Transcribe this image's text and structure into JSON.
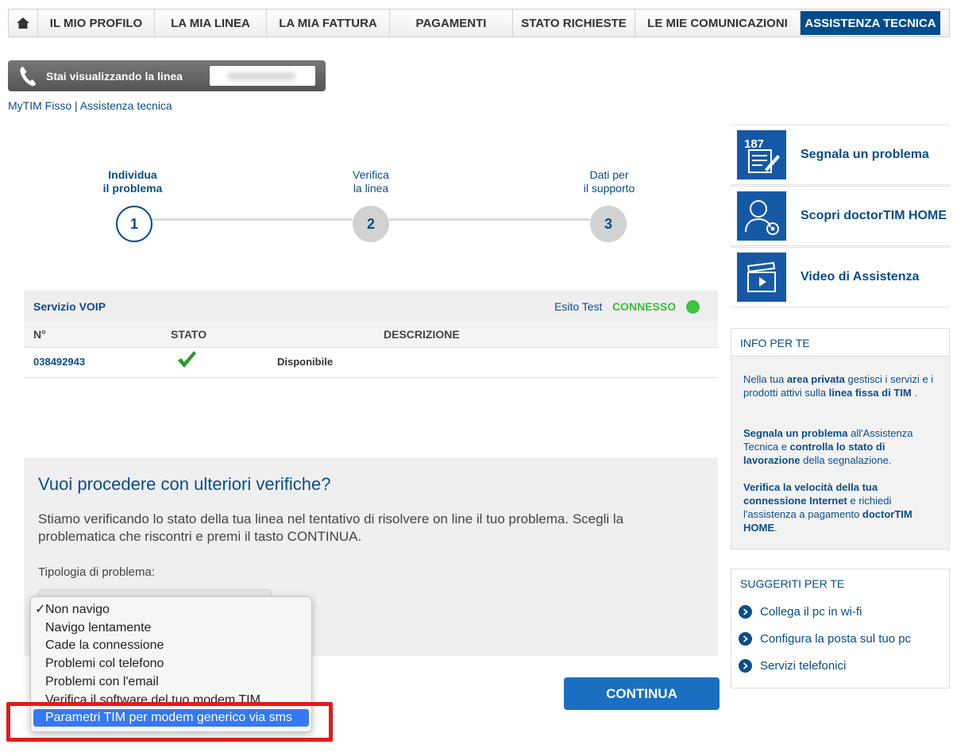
{
  "nav": {
    "items": [
      "IL MIO PROFILO",
      "LA MIA LINEA",
      "LA MIA FATTURA",
      "PAGAMENTI",
      "STATO RICHIESTE",
      "LE MIE COMUNICAZIONI",
      "ASSISTENZA TECNICA"
    ]
  },
  "linebar": {
    "label": "Stai visualizzando la linea"
  },
  "breadcrumb": {
    "root": "MyTIM Fisso",
    "sep": "|",
    "current": "Assistenza tecnica"
  },
  "steps": [
    {
      "line1": "Individua",
      "line2": "il problema",
      "num": "1"
    },
    {
      "line1": "Verifica",
      "line2": "la linea",
      "num": "2"
    },
    {
      "line1": "Dati per",
      "line2": "il supporto",
      "num": "3"
    }
  ],
  "voip": {
    "title": "Servizio VOIP",
    "esito_label": "Esito Test",
    "esito_value": "CONNESSO",
    "headers": [
      "N°",
      "STATO",
      "DESCRIZIONE"
    ],
    "rows": [
      {
        "num": "038492943",
        "desc": "Disponibile"
      }
    ]
  },
  "verify": {
    "title": "Vuoi procedere con ulteriori verifiche?",
    "text": "Stiamo verificando lo stato della tua linea nel tentativo di risolvere on line il tuo problema. Scegli la problematica che riscontri e premi il tasto CONTINUA.",
    "tipologia_label": "Tipologia di problema:",
    "options": [
      "Non navigo",
      "Navigo lentamente",
      "Cade la connessione",
      "Problemi col telefono",
      "Problemi con l'email",
      "Verifica il software del tuo modem TIM",
      "Parametri TIM per modem generico via sms"
    ],
    "checkmark": "✓"
  },
  "continua_label": "CONTINUA",
  "side": {
    "cards": [
      "Segnala un problema",
      "Scopri doctorTIM HOME",
      "Video di Assistenza"
    ],
    "icon_187": "187",
    "info": {
      "title": "INFO PER TE",
      "p1_a": "Nella tua ",
      "p1_b": "area privata",
      "p1_c": " gestisci i servizi e i prodotti attivi sulla ",
      "p1_d": "linea fissa di TIM",
      "p1_e": " .",
      "p2_a": "Segnala un problema",
      "p2_b": " all'Assistenza Tecnica e ",
      "p2_c": "controlla lo stato di lavorazione",
      "p2_d": " della segnalazione.",
      "p3_a": "Verifica la velocità della tua connessione Internet",
      "p3_b": " e richiedi l'assistenza a pagamento ",
      "p3_c": "doctorTIM HOME",
      "p3_d": "."
    },
    "suggeriti": {
      "title": "SUGGERITI PER TE",
      "items": [
        "Collega il pc in wi-fi",
        "Configura la posta sul tuo pc",
        "Servizi telefonici"
      ]
    }
  },
  "colors": {
    "brand": "#004d8c",
    "link": "#0a4d8c",
    "success": "#3cc43c",
    "highlight": "#e21b1b",
    "selection": "#3478f6"
  }
}
